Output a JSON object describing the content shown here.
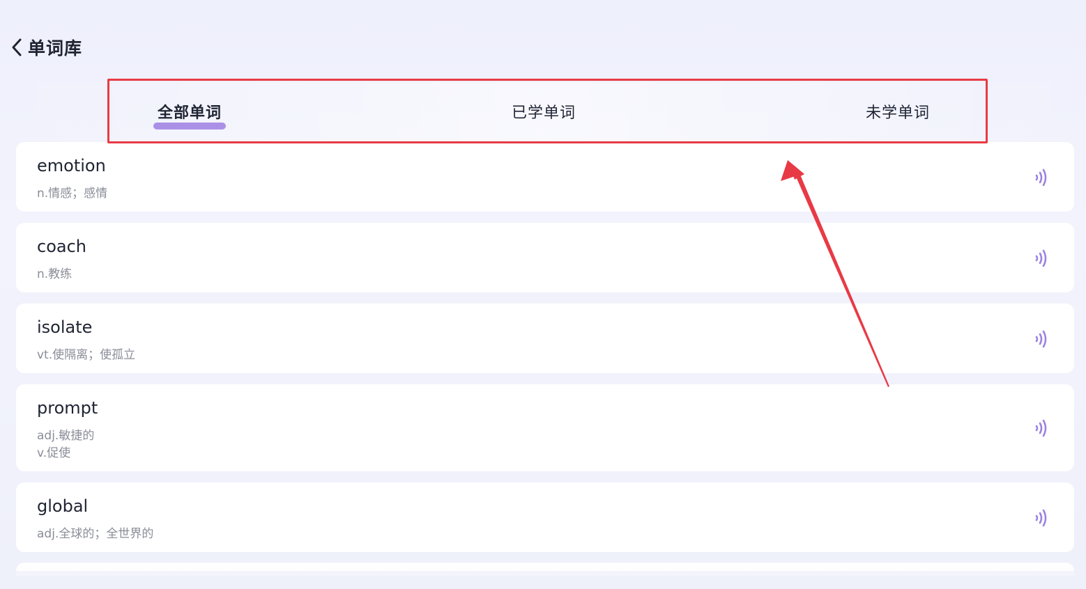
{
  "header": {
    "title": "单词库",
    "back_icon": "chevron-left-icon"
  },
  "tabs": [
    {
      "label": "全部单词",
      "active": true
    },
    {
      "label": "已学单词",
      "active": false
    },
    {
      "label": "未学单词",
      "active": false
    }
  ],
  "words": [
    {
      "word": "emotion",
      "meanings": [
        "n.情感；感情"
      ]
    },
    {
      "word": "coach",
      "meanings": [
        "n.教练"
      ]
    },
    {
      "word": "isolate",
      "meanings": [
        "vt.使隔离；使孤立"
      ]
    },
    {
      "word": "prompt",
      "meanings": [
        "adj.敏捷的",
        "v.促使"
      ]
    },
    {
      "word": "global",
      "meanings": [
        "adj.全球的；全世界的"
      ]
    }
  ],
  "icons": {
    "speaker": "speaker-icon"
  },
  "colors": {
    "accent": "#9c7fe0",
    "annotation": "#e83a45",
    "speaker": "#9c83e0"
  }
}
